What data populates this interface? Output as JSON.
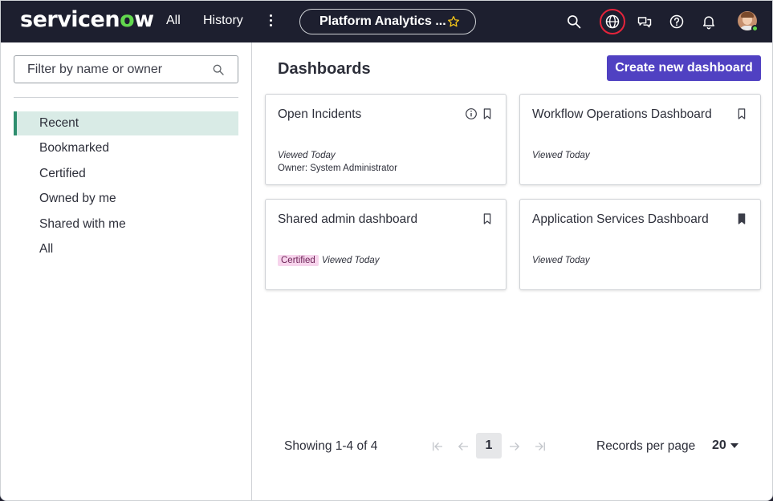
{
  "header": {
    "logo_prefix": "servicen",
    "logo_o": "o",
    "logo_suffix": "w",
    "nav_all": "All",
    "nav_history": "History",
    "app_pill": "Platform Analytics ...",
    "icons": [
      "search-icon",
      "globe-icon",
      "chat-icon",
      "help-icon",
      "bell-icon",
      "avatar"
    ],
    "colors": {
      "bg": "#1d1f2f",
      "logo_accent": "#62d84e",
      "globe_ring": "#e5243b"
    }
  },
  "sidebar": {
    "filter_placeholder": "Filter by name or owner",
    "items": [
      {
        "label": "Recent",
        "active": true
      },
      {
        "label": "Bookmarked"
      },
      {
        "label": "Certified"
      },
      {
        "label": "Owned by me"
      },
      {
        "label": "Shared with me"
      },
      {
        "label": "All"
      }
    ],
    "active_color": "#d9ebe6"
  },
  "main": {
    "title": "Dashboards",
    "create_button": "Create new dashboard",
    "create_button_color": "#5041c2",
    "cards": [
      {
        "title": "Open Incidents",
        "viewed": "Viewed Today",
        "owner": "Owner: System Administrator",
        "bookmarked": false,
        "info": true
      },
      {
        "title": "Workflow Operations Dashboard",
        "viewed": "Viewed Today",
        "bookmarked": false
      },
      {
        "title": "Shared admin dashboard",
        "badge": "Certified",
        "viewed": "Viewed Today",
        "bookmarked": false
      },
      {
        "title": "Application Services Dashboard",
        "viewed": "Viewed Today",
        "bookmarked": true
      }
    ]
  },
  "pagination": {
    "showing": "Showing 1-4 of 4",
    "current_page": "1",
    "records_label": "Records per page",
    "records_value": "20"
  }
}
